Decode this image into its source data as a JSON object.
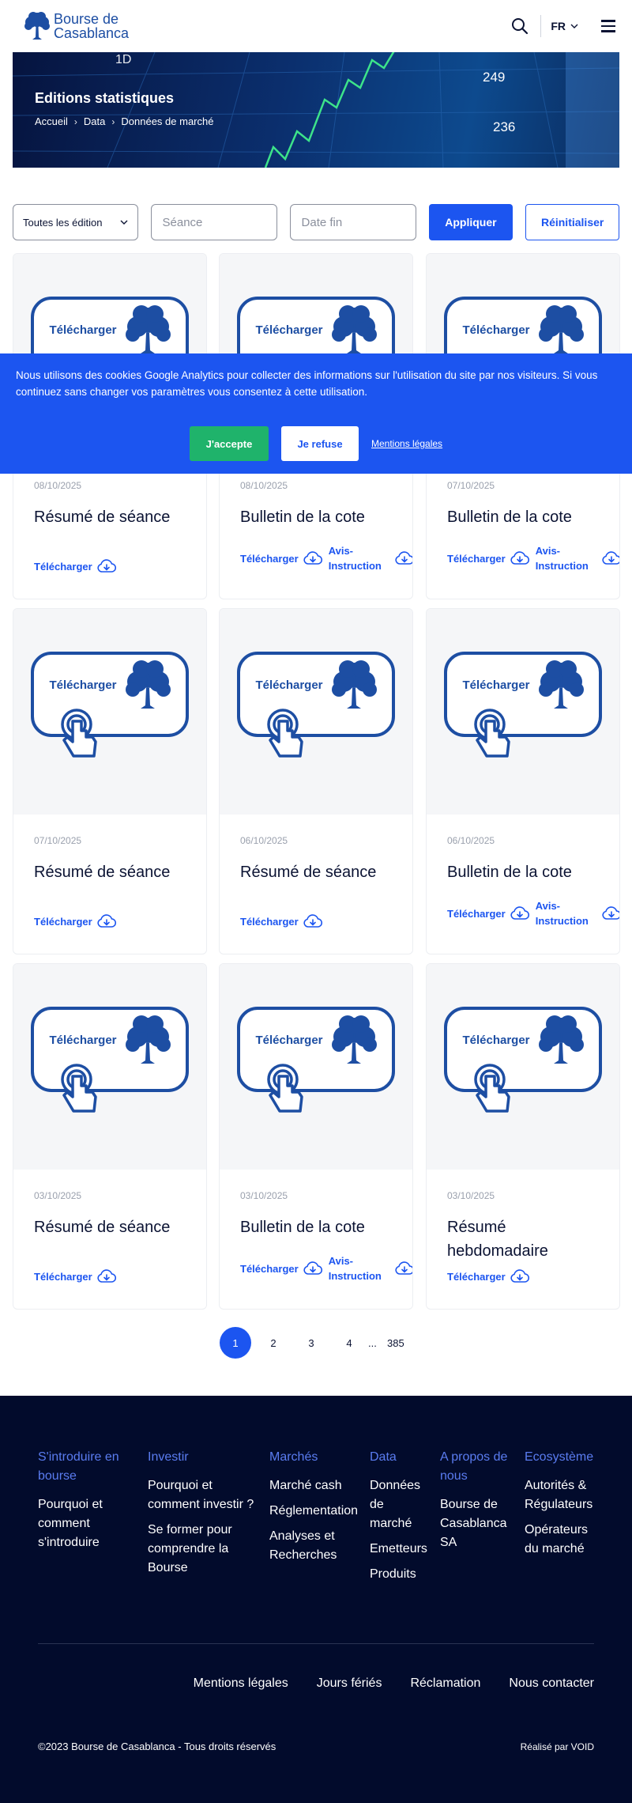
{
  "header": {
    "logo_line1": "Bourse de",
    "logo_line2": "Casablanca",
    "language": "FR"
  },
  "hero": {
    "title": "Editions statistiques",
    "breadcrumb": [
      "Accueil",
      "Data",
      "Données de marché"
    ],
    "ticker_numbers": [
      "249",
      "236",
      "1D"
    ]
  },
  "filters": {
    "edition_select": "Toutes les édition",
    "seance_placeholder": "Séance",
    "date_fin_placeholder": "Date fin",
    "apply_label": "Appliquer",
    "reset_label": "Réinitialiser"
  },
  "card_image": {
    "label": "Télécharger"
  },
  "cards": [
    {
      "date": "08/10/2025",
      "title": "Résumé de séance",
      "download": "Télécharger",
      "avis": ""
    },
    {
      "date": "08/10/2025",
      "title": "Bulletin de la cote",
      "download": "Télécharger",
      "avis": "Avis-Instruction"
    },
    {
      "date": "07/10/2025",
      "title": "Bulletin de la cote",
      "download": "Télécharger",
      "avis": "Avis-Instruction"
    },
    {
      "date": "07/10/2025",
      "title": "Résumé de séance",
      "download": "Télécharger",
      "avis": ""
    },
    {
      "date": "06/10/2025",
      "title": "Résumé de séance",
      "download": "Télécharger",
      "avis": ""
    },
    {
      "date": "06/10/2025",
      "title": "Bulletin de la cote",
      "download": "Télécharger",
      "avis": "Avis-Instruction"
    },
    {
      "date": "03/10/2025",
      "title": "Résumé de séance",
      "download": "Télécharger",
      "avis": ""
    },
    {
      "date": "03/10/2025",
      "title": "Bulletin de la cote",
      "download": "Télécharger",
      "avis": "Avis-Instruction"
    },
    {
      "date": "03/10/2025",
      "title": "Résumé hebdomadaire",
      "download": "Télécharger",
      "avis": ""
    }
  ],
  "cookie": {
    "text": "Nous utilisons des cookies Google Analytics pour collecter des informations sur l'utilisation du site par nos visiteurs. Si vous continuez sans changer vos paramètres vous consentez à cette utilisation.",
    "accept_label": "J'accepte",
    "refuse_label": "Je refuse",
    "legal_link": "Mentions légales"
  },
  "pagination": {
    "pages": [
      "1",
      "2",
      "3",
      "4"
    ],
    "ellipsis": "...",
    "last": "385",
    "current": "1"
  },
  "footer": {
    "columns": [
      {
        "heading": "S'introduire en bourse",
        "links": [
          "Pourquoi et comment s'introduire"
        ]
      },
      {
        "heading": "Investir",
        "links": [
          "Pourquoi et comment investir ?",
          "Se former pour comprendre la Bourse"
        ]
      },
      {
        "heading": "Marchés",
        "links": [
          "Marché cash",
          "Réglementation",
          "Analyses et Recherches"
        ]
      },
      {
        "heading": "Data",
        "links": [
          "Données de marché",
          "Emetteurs",
          "Produits"
        ]
      },
      {
        "heading": "A propos de nous",
        "links": [
          "Bourse de Casablanca SA"
        ]
      },
      {
        "heading": "Ecosystème",
        "links": [
          "Autorités & Régulateurs",
          "Opérateurs du marché"
        ]
      }
    ],
    "bottom_links": [
      "Mentions légales",
      "Jours fériés",
      "Réclamation",
      "Nous contacter"
    ],
    "copyright": "©2023 Bourse de Casablanca - Tous droits réservés",
    "made_by": "Réalisé par VOID"
  },
  "colors": {
    "primary": "#1c55f0",
    "accept": "#1fb36b",
    "footer_bg": "#020b2c",
    "footer_heading": "#5a7cf0",
    "brand_blue": "#1d4ea3"
  }
}
